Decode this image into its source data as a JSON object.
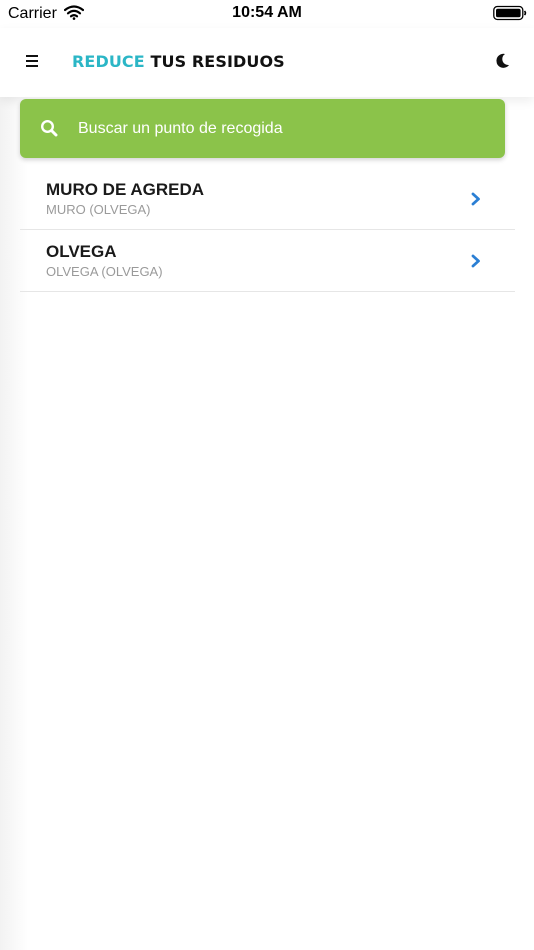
{
  "status_bar": {
    "carrier": "Carrier",
    "time": "10:54 AM",
    "wifi_icon": "wifi-icon",
    "battery_icon": "battery-icon"
  },
  "header": {
    "brand_part1": "REDUCE",
    "brand_part2": "TUS RESIDUOS",
    "menu_icon": "hamburger-menu-icon",
    "theme_icon": "moon-icon"
  },
  "search": {
    "placeholder": "Buscar un punto de recogida",
    "value": "",
    "icon": "search-icon"
  },
  "locations": [
    {
      "title": "MURO DE AGREDA",
      "subtitle": "MURO (OLVEGA)"
    },
    {
      "title": "OLVEGA",
      "subtitle": "OLVEGA (OLVEGA)"
    }
  ],
  "colors": {
    "brand_accent": "#2bb6c6",
    "search_background": "#8bc34a",
    "chevron": "#2b7fd4",
    "title_text": "#1a1a1a",
    "subtitle_text": "#9a9a9a"
  }
}
